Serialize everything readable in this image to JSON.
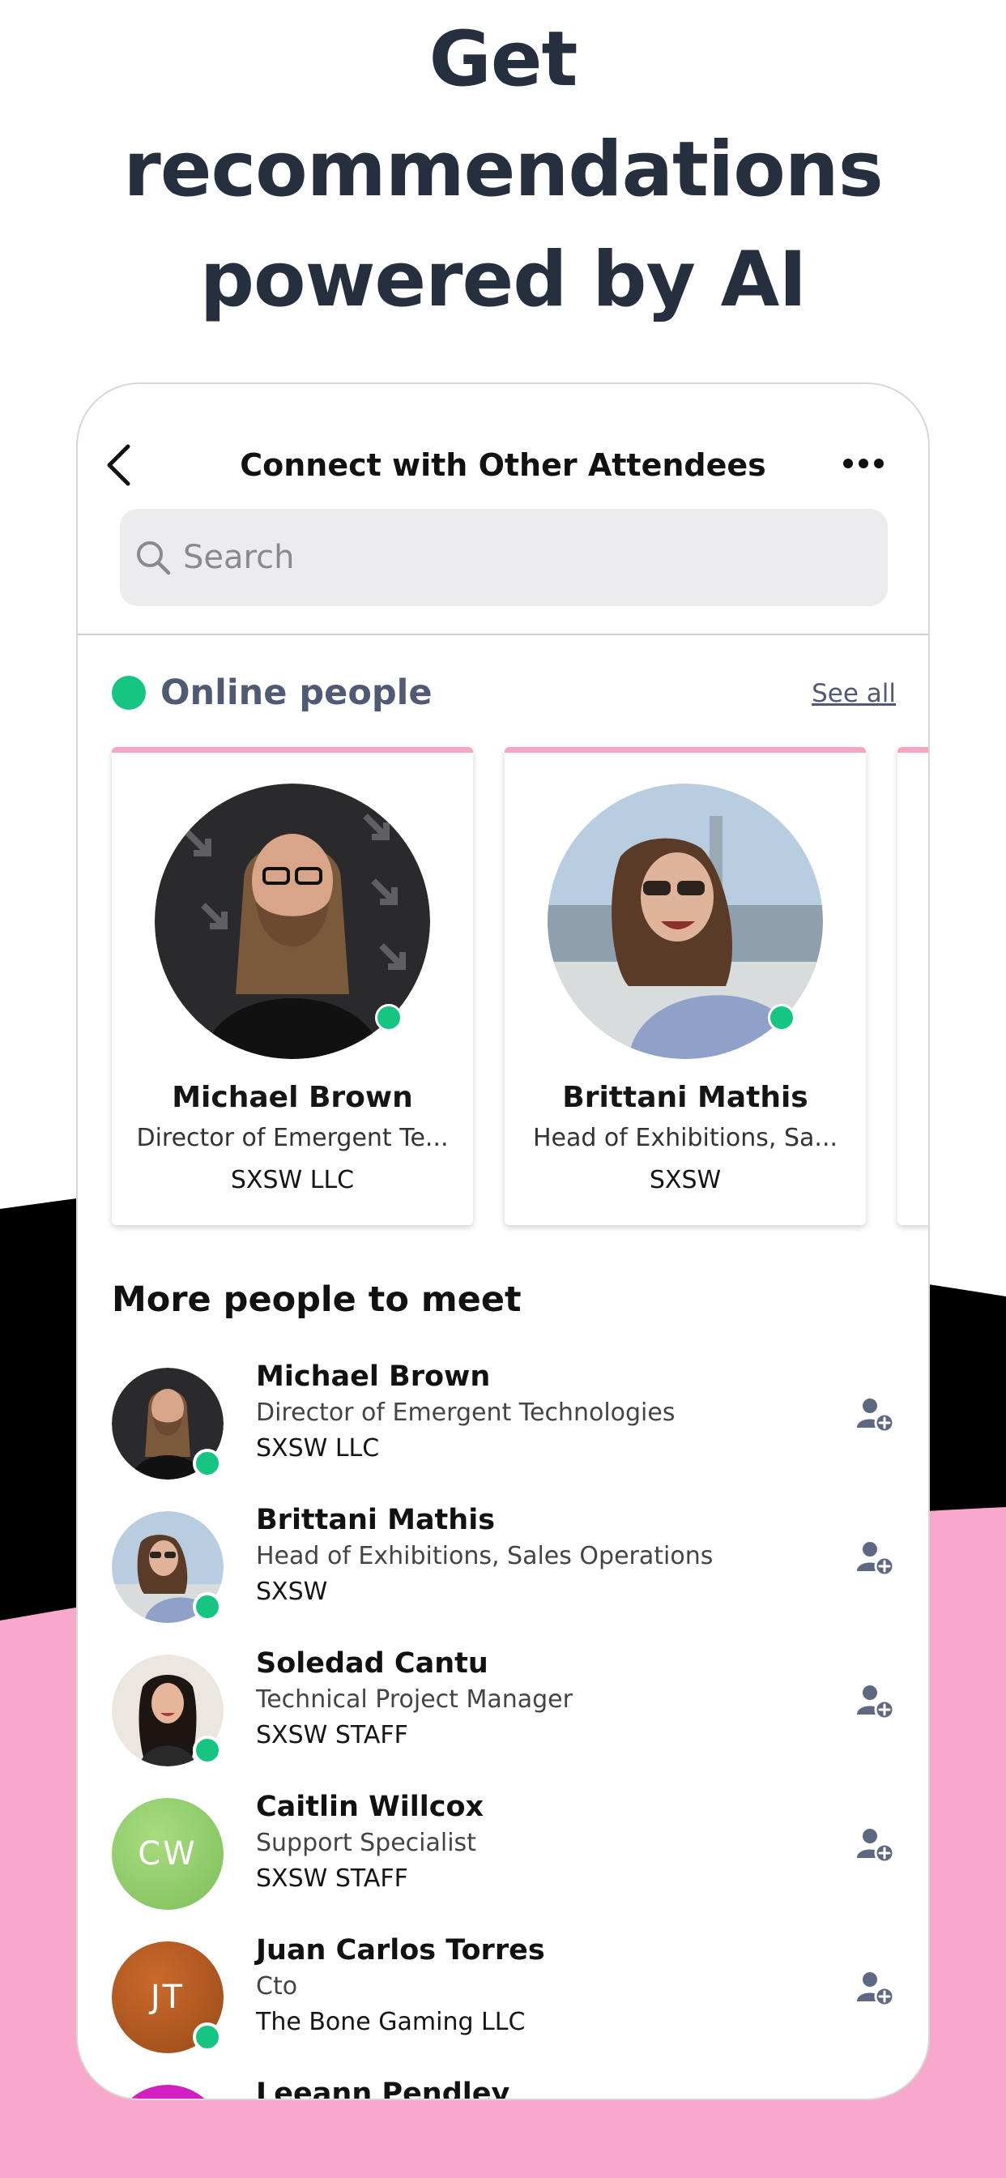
{
  "headline": {
    "line1": "Get",
    "line2": "recommendations",
    "line3": "powered by AI"
  },
  "colors": {
    "headline": "#262f3d",
    "pink_wave": "#f7a8cb",
    "black_wave": "#000000",
    "online_green": "#17c582",
    "section_grey": "#505a74",
    "card_accent": "#f3a6c6"
  },
  "nav": {
    "back_icon": "chevron-left-icon",
    "title": "Connect with Other Attendees",
    "more_icon": "more-horizontal-icon"
  },
  "search": {
    "icon": "search-icon",
    "placeholder": "Search",
    "value": ""
  },
  "online": {
    "title": "Online people",
    "see_all": "See all",
    "cards": [
      {
        "name": "Michael Brown",
        "role": "Director of Emergent Te...",
        "company": "SXSW LLC"
      },
      {
        "name": "Brittani Mathis",
        "role": "Head of Exhibitions,  Sa...",
        "company": "SXSW"
      }
    ]
  },
  "more": {
    "title": "More people to meet",
    "add_icon": "add-contact-icon",
    "people": [
      {
        "name": "Michael Brown",
        "role": "Director of Emergent Technologies",
        "company": "SXSW LLC",
        "online": true
      },
      {
        "name": "Brittani Mathis",
        "role": "Head of Exhibitions,  Sales Operations",
        "company": "SXSW",
        "online": true
      },
      {
        "name": "Soledad Cantu",
        "role": "Technical Project Manager",
        "company": "SXSW STAFF",
        "online": true
      },
      {
        "name": "Caitlin Willcox",
        "initials": "CW",
        "avatar_color": "#8fcf6a",
        "role": "Support Specialist",
        "company": "SXSW STAFF",
        "online": false
      },
      {
        "name": "Juan Carlos Torres",
        "initials": "JT",
        "avatar_color": "#b0561f",
        "role": "Cto",
        "company": "The Bone Gaming LLC",
        "online": true
      },
      {
        "name": "Leeann Pendley",
        "avatar_color": "#d21fc2",
        "online": false
      }
    ]
  }
}
